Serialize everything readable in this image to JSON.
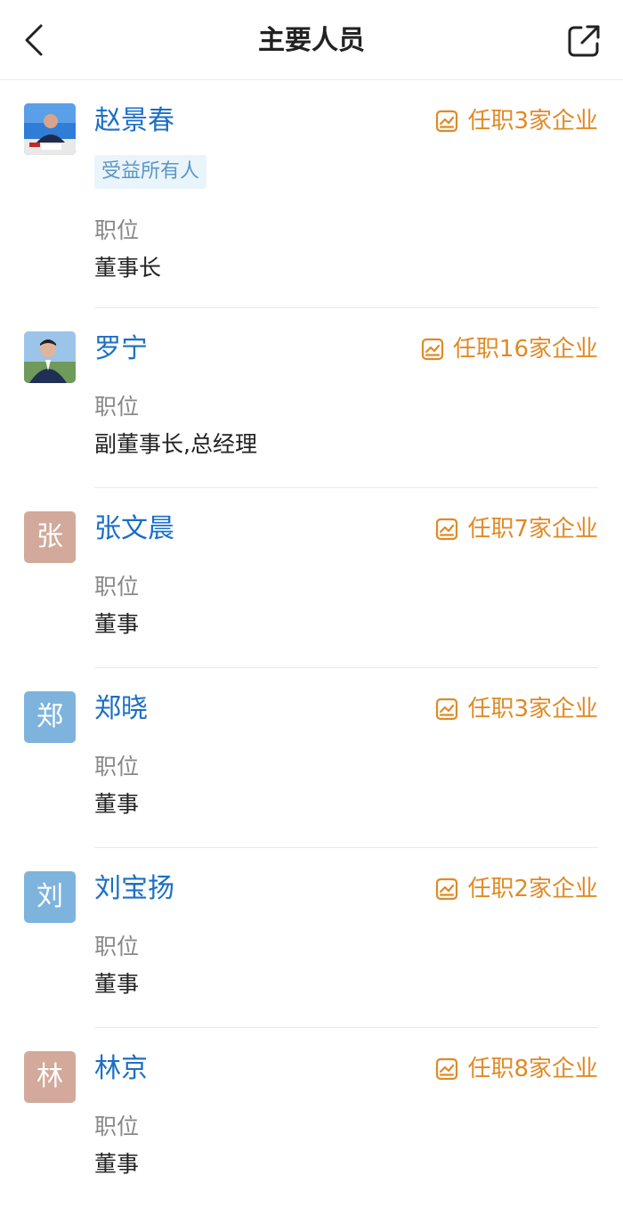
{
  "header": {
    "title": "主要人员",
    "back_icon": "chevron-left-icon",
    "share_icon": "share-external-icon"
  },
  "colors": {
    "name_link": "#1c6fc6",
    "roles_link": "#e08a26",
    "tag_bg": "#eaf4fb",
    "tag_text": "#5b97c6",
    "label_gray": "#888888",
    "avatar_tan": "#d2a99a",
    "avatar_blue": "#7eb3de"
  },
  "persons": [
    {
      "name": "赵景春",
      "avatar_type": "photo",
      "tag": "受益所有人",
      "roles_text": "任职3家企业",
      "position_label": "职位",
      "position": "董事长"
    },
    {
      "name": "罗宁",
      "avatar_type": "photo",
      "roles_text": "任职16家企业",
      "position_label": "职位",
      "position": "副董事长,总经理"
    },
    {
      "name": "张文晨",
      "avatar_char": "张",
      "avatar_color": "tan",
      "roles_text": "任职7家企业",
      "position_label": "职位",
      "position": "董事"
    },
    {
      "name": "郑晓",
      "avatar_char": "郑",
      "avatar_color": "blue",
      "roles_text": "任职3家企业",
      "position_label": "职位",
      "position": "董事"
    },
    {
      "name": "刘宝扬",
      "avatar_char": "刘",
      "avatar_color": "blue",
      "roles_text": "任职2家企业",
      "position_label": "职位",
      "position": "董事"
    },
    {
      "name": "林京",
      "avatar_char": "林",
      "avatar_color": "tan",
      "roles_text": "任职8家企业",
      "position_label": "职位",
      "position": "董事"
    }
  ]
}
